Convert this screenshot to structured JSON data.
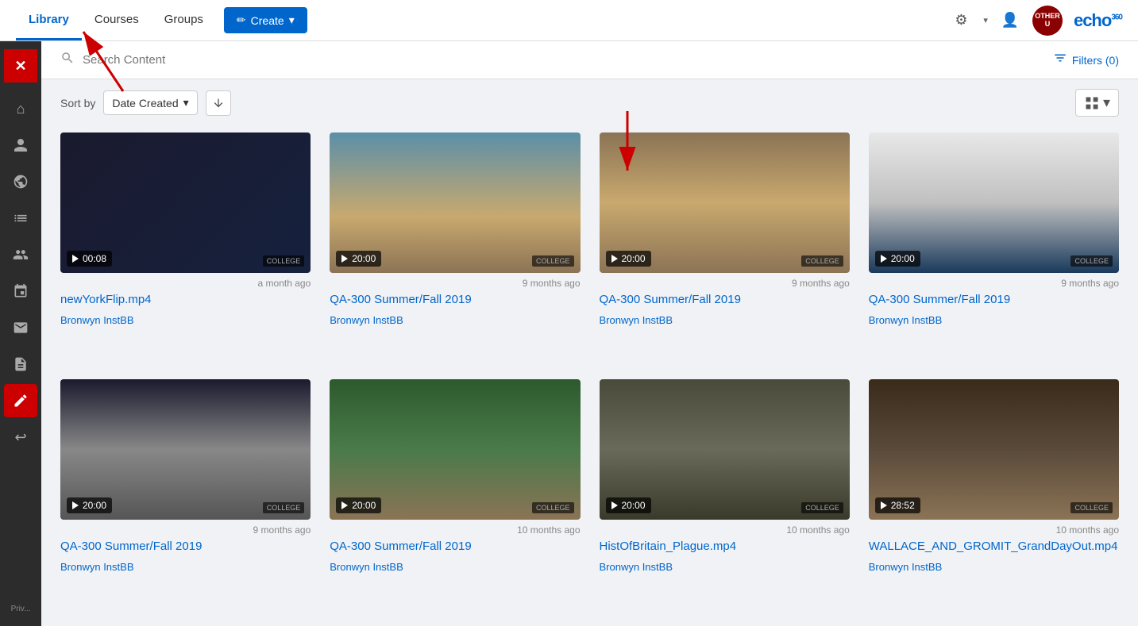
{
  "nav": {
    "tabs": [
      {
        "id": "library",
        "label": "Library",
        "active": true
      },
      {
        "id": "courses",
        "label": "Courses",
        "active": false
      },
      {
        "id": "groups",
        "label": "Groups",
        "active": false
      }
    ],
    "create_label": "Create",
    "filters_label": "Filters (0)",
    "search_placeholder": "Search Content",
    "echo_logo": "echo",
    "echo_logo_superscript": "360"
  },
  "sort": {
    "label": "Sort by",
    "selected": "Date Created",
    "direction": "↓",
    "view_icon": "⊞"
  },
  "sidebar": {
    "items": [
      {
        "id": "close",
        "icon": "✕",
        "type": "close"
      },
      {
        "id": "home",
        "icon": "⌂"
      },
      {
        "id": "person",
        "icon": "👤"
      },
      {
        "id": "globe",
        "icon": "🌐"
      },
      {
        "id": "list",
        "icon": "☰"
      },
      {
        "id": "group",
        "icon": "👥"
      },
      {
        "id": "calendar",
        "icon": "📅"
      },
      {
        "id": "mail",
        "icon": "✉"
      },
      {
        "id": "doc",
        "icon": "📄"
      },
      {
        "id": "edit-highlight",
        "icon": "✏",
        "highlight": true
      },
      {
        "id": "back",
        "icon": "↩"
      }
    ],
    "bottom_label": "Priv..."
  },
  "media_items": [
    {
      "id": 1,
      "thumb_class": "thumb-dark",
      "duration": "00:08",
      "time_ago": "a month ago",
      "title": "newYorkFlip.mp4",
      "author": "Bronwyn InstBB",
      "college": "COLLEGE"
    },
    {
      "id": 2,
      "thumb_class": "thumb-beach",
      "duration": "20:00",
      "time_ago": "9 months ago",
      "title": "QA-300 Summer/Fall 2019",
      "author": "Bronwyn InstBB",
      "college": "COLLEGE"
    },
    {
      "id": 3,
      "thumb_class": "thumb-desert",
      "duration": "20:00",
      "time_ago": "9 months ago",
      "title": "QA-300 Summer/Fall 2019",
      "author": "Bronwyn InstBB",
      "college": "COLLEGE"
    },
    {
      "id": 4,
      "thumb_class": "thumb-snow",
      "duration": "20:00",
      "time_ago": "9 months ago",
      "title": "QA-300 Summer/Fall 2019",
      "author": "Bronwyn InstBB",
      "college": "COLLEGE"
    },
    {
      "id": 5,
      "thumb_class": "thumb-clouds",
      "duration": "20:00",
      "time_ago": "9 months ago",
      "title": "QA-300 Summer/Fall 2019",
      "author": "Bronwyn InstBB",
      "college": "COLLEGE"
    },
    {
      "id": 6,
      "thumb_class": "thumb-green",
      "duration": "20:00",
      "time_ago": "10 months ago",
      "title": "QA-300 Summer/Fall 2019",
      "author": "Bronwyn InstBB",
      "college": "COLLEGE"
    },
    {
      "id": 7,
      "thumb_class": "thumb-rocks",
      "duration": "20:00",
      "time_ago": "10 months ago",
      "title": "HistOfBritain_Plague.mp4",
      "author": "Bronwyn InstBB",
      "college": "COLLEGE"
    },
    {
      "id": 8,
      "thumb_class": "thumb-interior",
      "duration": "28:52",
      "time_ago": "10 months ago",
      "title": "WALLACE_AND_GROMIT_GrandDayOut.mp4",
      "author": "Bronwyn InstBB",
      "college": "COLLEGE"
    }
  ]
}
